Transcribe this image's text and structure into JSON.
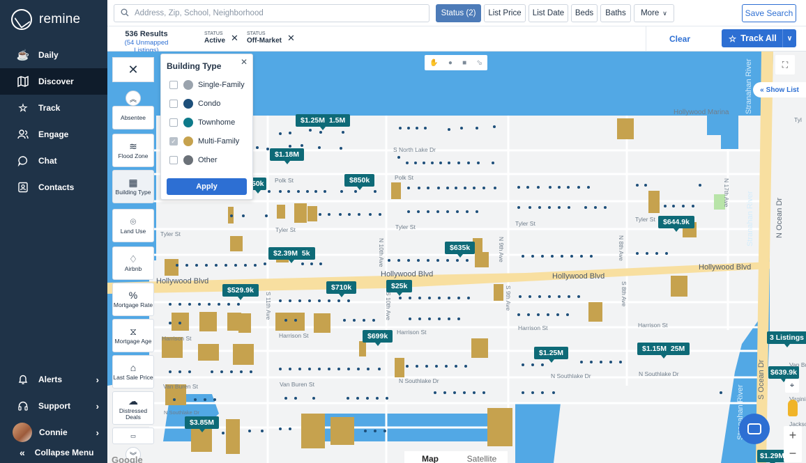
{
  "brand": {
    "name": "remine"
  },
  "sidebar": {
    "items": [
      {
        "label": "Daily",
        "icon": "cup-icon"
      },
      {
        "label": "Discover",
        "icon": "map-icon"
      },
      {
        "label": "Track",
        "icon": "star-icon"
      },
      {
        "label": "Engage",
        "icon": "people-icon"
      },
      {
        "label": "Chat",
        "icon": "chat-icon"
      },
      {
        "label": "Contacts",
        "icon": "contacts-icon"
      }
    ],
    "bottom_items": [
      {
        "label": "Alerts",
        "icon": "bell-icon"
      },
      {
        "label": "Support",
        "icon": "headset-icon"
      },
      {
        "label": "Connie",
        "icon": "avatar"
      }
    ],
    "collapse_label": "Collapse Menu"
  },
  "topbar": {
    "search_placeholder": "Address, Zip, School, Neighborhood",
    "filters": [
      "Status (2)",
      "List Price",
      "List Date",
      "Beds",
      "Baths",
      "More"
    ],
    "save_search": "Save Search"
  },
  "results": {
    "count": "536 Results",
    "unmapped": "(54 Unmapped Listings)",
    "chips": [
      {
        "label": "STATUS",
        "value": "Active"
      },
      {
        "label": "STATUS",
        "value": "Off-Market"
      }
    ],
    "clear": "Clear",
    "track_all": "Track All"
  },
  "filter_rail": [
    "Absentee",
    "Flood Zone",
    "Building Type",
    "Land Use",
    "Airbnb",
    "Mortgage Rate",
    "Mortgage Age",
    "Last Sale Price",
    "Distressed Deals"
  ],
  "building_type": {
    "title": "Building Type",
    "options": [
      {
        "label": "Single-Family",
        "color": "#9aa3ad",
        "checked": false
      },
      {
        "label": "Condo",
        "color": "#1d4f7a",
        "checked": false
      },
      {
        "label": "Townhome",
        "color": "#0e7a8a",
        "checked": false
      },
      {
        "label": "Multi-Family",
        "color": "#c6a24e",
        "checked": true
      },
      {
        "label": "Other",
        "color": "#6b7178",
        "checked": false
      }
    ],
    "apply": "Apply"
  },
  "map": {
    "show_list": "Show List",
    "map_type": [
      "Map",
      "Satellite"
    ],
    "google": "Google",
    "price_tags": [
      "$1.25M",
      "1.5M",
      "$1.18M",
      "$850k",
      "50k",
      "$644.9k",
      "$635k",
      "$2.39M",
      "5k",
      "$529.9k",
      "$710k",
      "$25k",
      "$699k",
      "$1.25M",
      "$1.15M",
      "25M",
      "3 Listings",
      "$639.9k",
      "$3.85M",
      "$1.29M"
    ],
    "streets": [
      "S North Lake Dr",
      "Polk St",
      "Polk St",
      "Tyler St",
      "Tyler St",
      "Tyler St",
      "Tyler St",
      "Tyler St",
      "Harrison St",
      "Harrison St",
      "Harrison St",
      "Harrison St",
      "Harrison St",
      "Van Buren St",
      "Van Buren St",
      "N Southlake Dr",
      "N Southlake Dr",
      "N Southlake Dr",
      "N Southlake Dr",
      "Hollywood Marina",
      "N 10th Ave",
      "N 9th Ave",
      "N 8th Ave",
      "S 9th Ave",
      "S 8th Ave",
      "S 10th Ave",
      "N 17th Ave",
      "S 11th Ave"
    ],
    "roads": [
      "Hollywood Blvd",
      "Hollywood Blvd",
      "Hollywood Blvd",
      "Hollywood Blvd"
    ],
    "water": [
      "Stranahan River",
      "Stranahan River",
      "Stranahan River",
      "N Ocean Dr",
      "S Ocean Dr"
    ],
    "partial_labels": [
      "Virginia St",
      "Jackson St",
      "Van Buren",
      "Tyl"
    ]
  }
}
